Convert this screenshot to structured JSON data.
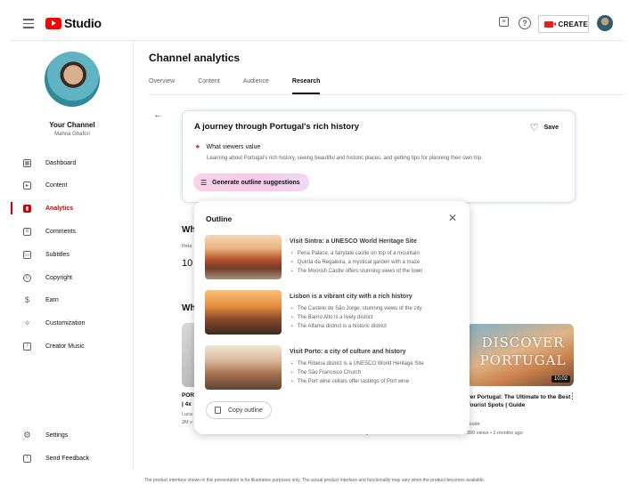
{
  "header": {
    "brand": "Studio",
    "create_label": "CREATE"
  },
  "channel": {
    "name": "Your Channel",
    "user": "Mahna Ghafori"
  },
  "sidebar": {
    "items": [
      {
        "label": "Dashboard",
        "icon": "grid-icon"
      },
      {
        "label": "Content",
        "icon": "play-square-icon"
      },
      {
        "label": "Analytics",
        "icon": "bar-chart-icon",
        "active": true
      },
      {
        "label": "Comments",
        "icon": "comment-icon"
      },
      {
        "label": "Subtitles",
        "icon": "subtitles-icon"
      },
      {
        "label": "Copyright",
        "icon": "copyright-icon"
      },
      {
        "label": "Earn",
        "icon": "dollar-icon"
      },
      {
        "label": "Customization",
        "icon": "wand-icon"
      },
      {
        "label": "Creator Music",
        "icon": "music-note-icon"
      }
    ],
    "bottom": [
      {
        "label": "Settings",
        "icon": "gear-icon"
      },
      {
        "label": "Send Feedback",
        "icon": "feedback-icon"
      }
    ]
  },
  "main": {
    "title": "Channel analytics",
    "tabs": [
      "Overview",
      "Content",
      "Audience",
      "Research"
    ],
    "active_tab": "Research"
  },
  "research": {
    "title": "A journey through Portugal's rich history",
    "save_label": "Save",
    "viewers_label": "What viewers value",
    "description": "Learning about Portugal's rich history, seeing beautiful and historic places, and getting tips for planning their own trip.",
    "generate_label": "Generate outline suggestions"
  },
  "background": {
    "wh1": "Wh",
    "rela": "Rela",
    "ten": "10",
    "wh2": "Wh",
    "left_video_lines": [
      "POR",
      "| 4x",
      "Luca",
      "2M v"
    ],
    "left_video_stats": "374 views • 4 months ago",
    "discover_line1": "DISCOVER",
    "discover_line2": "PORTUGAL",
    "duration": "10:02",
    "right_video_title": "ver Portugal: The Ultimate to the Best Tourist Spots | Guide",
    "right_video_channel": "Guide",
    "right_video_stats": "390 views • 2 months ago"
  },
  "outline": {
    "title": "Outline",
    "copy_label": "Copy outline",
    "items": [
      {
        "heading": "Visit Sintra: a UNESCO World Heritage Site",
        "bullets": [
          "Pena Palace, a fairytale castle on top of a mountain",
          "Quinta da Regaleira, a mystical garden with a maze",
          "The Moorish Castle offers stunning views of the town"
        ]
      },
      {
        "heading": "Lisbon is a vibrant city with a rich history",
        "bullets": [
          "The Castelo de São Jorge, stunning views of the city",
          "The Bairro Alto is a lively district",
          "The Alfama district is a historic district"
        ]
      },
      {
        "heading": "Visit Porto: a city of culture and history",
        "bullets": [
          "The Ribeira district is a UNESCO World Heritage Site",
          "The São Francisco Church",
          "The Port wine cellars offer tastings of Port wine"
        ]
      }
    ]
  },
  "disclaimer": "The product interface shown in this presentation is for illustrative purposes only. The actual product interface and functionality may vary when the product becomes available."
}
